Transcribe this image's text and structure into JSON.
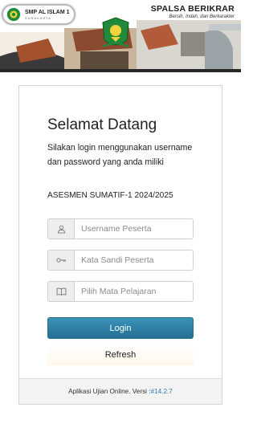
{
  "header": {
    "school_name": "SMP AL ISLAM 1",
    "school_city": "SURAKARTA",
    "motto_title": "SPALSA BERIKRAR",
    "motto_sub": "Bersih, Indah, dan Berkarakter"
  },
  "login": {
    "title": "Selamat Datang",
    "intro": "Silakan login menggunakan username dan password yang anda miliki",
    "exam_name": "ASESMEN SUMATIF-1 2024/2025",
    "username_placeholder": "Username Peserta",
    "password_placeholder": "Kata Sandi Peserta",
    "subject_placeholder": "Pilih Mata Pelajaran",
    "login_label": "Login",
    "refresh_label": "Refresh"
  },
  "footer": {
    "app_text": "Aplikasi Ujian Online. Versi : ",
    "version": "#14.2.7"
  },
  "icons": {
    "username": "user-icon",
    "password": "key-icon",
    "subject": "book-icon"
  },
  "colors": {
    "login_button": "#2e83a8",
    "version_link": "#2a7ab0",
    "crest_green": "#1f8a3a"
  }
}
